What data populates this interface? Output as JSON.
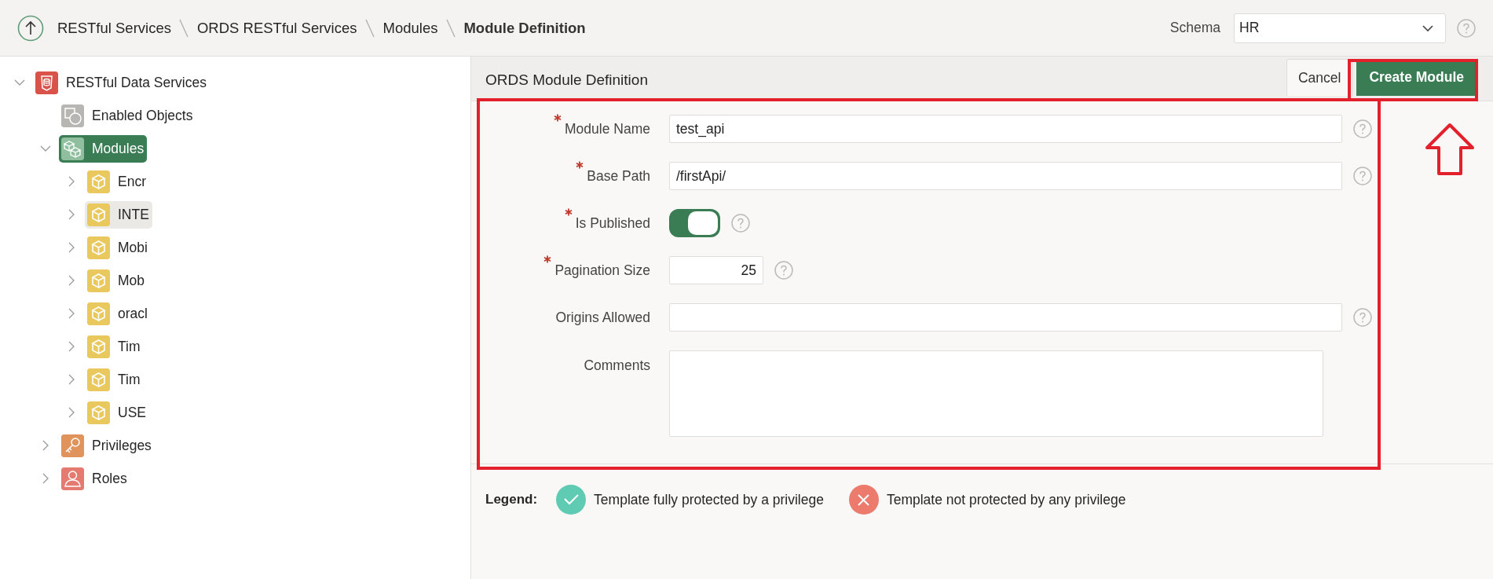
{
  "breadcrumbs": [
    {
      "label": "RESTful Services",
      "current": false
    },
    {
      "label": "ORDS RESTful Services",
      "current": false
    },
    {
      "label": "Modules",
      "current": false
    },
    {
      "label": "Module Definition",
      "current": true
    }
  ],
  "schema": {
    "label": "Schema",
    "value": "HR"
  },
  "tree": [
    {
      "label": "RESTful Data Services",
      "kind": "database",
      "expanded": true,
      "selected": false,
      "children": [
        {
          "label": "Enabled Objects",
          "kind": "objects",
          "selected": false
        },
        {
          "label": "Modules",
          "kind": "modules",
          "expanded": true,
          "selected": true,
          "children": [
            {
              "label": "Encr",
              "kind": "module",
              "expanded": false,
              "selected": false,
              "hovered": false
            },
            {
              "label": "INTE",
              "kind": "module",
              "expanded": false,
              "selected": false,
              "hovered": true
            },
            {
              "label": "Mobi",
              "kind": "module",
              "expanded": false,
              "selected": false,
              "hovered": false
            },
            {
              "label": "Mob",
              "kind": "module",
              "expanded": false,
              "selected": false,
              "hovered": false
            },
            {
              "label": "oracl",
              "kind": "module",
              "expanded": false,
              "selected": false,
              "hovered": false
            },
            {
              "label": "Tim",
              "kind": "module",
              "expanded": false,
              "selected": false,
              "hovered": false
            },
            {
              "label": "Tim",
              "kind": "module",
              "expanded": false,
              "selected": false,
              "hovered": false
            },
            {
              "label": "USE",
              "kind": "module",
              "expanded": false,
              "selected": false,
              "hovered": false
            }
          ]
        },
        {
          "label": "Privileges",
          "kind": "key",
          "expanded": false,
          "selected": false
        },
        {
          "label": "Roles",
          "kind": "user",
          "expanded": false,
          "selected": false
        }
      ]
    }
  ],
  "region": {
    "title": "ORDS Module Definition",
    "buttons": [
      {
        "label": "Cancel",
        "kind": "secondary"
      },
      {
        "label": "Create Module",
        "kind": "primary"
      }
    ]
  },
  "fields": [
    {
      "label": "Module Name",
      "kind": "text",
      "required": true,
      "value": "test_api",
      "help": true
    },
    {
      "label": "Base Path",
      "kind": "text",
      "required": true,
      "value": "/firstApi/",
      "help": true
    },
    {
      "label": "Is Published",
      "kind": "switch",
      "required": true,
      "on": true,
      "help": true
    },
    {
      "label": "Pagination Size",
      "kind": "number",
      "required": true,
      "value": "25",
      "help": true
    },
    {
      "label": "Origins Allowed",
      "kind": "text",
      "required": false,
      "help": true
    },
    {
      "label": "Comments",
      "kind": "textarea",
      "required": false,
      "help": false
    }
  ],
  "legend": {
    "title": "Legend:",
    "items": [
      {
        "kind": "protected",
        "label": "Template fully protected by a privilege",
        "color": "#5fcbb3"
      },
      {
        "kind": "unprotected",
        "label": "Template not protected by any privilege",
        "color": "#ec7b6e"
      }
    ]
  }
}
